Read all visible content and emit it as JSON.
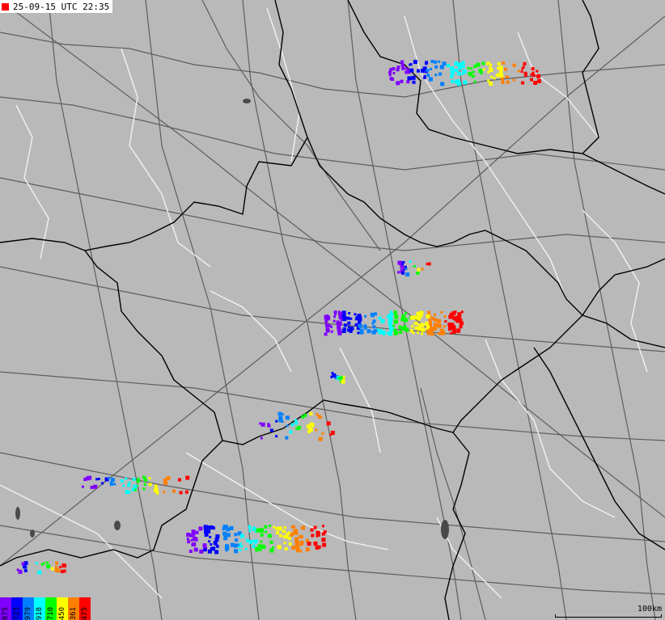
{
  "header": {
    "timestamp": "25-09-15 UTC 22:35",
    "marker_color": "#ff0000"
  },
  "legend": {
    "items": [
      {
        "label": "875",
        "color": "#8000ff"
      },
      {
        "label": "723",
        "color": "#0000ff"
      },
      {
        "label": "979",
        "color": "#0080ff"
      },
      {
        "label": "918",
        "color": "#00ffff"
      },
      {
        "label": "710",
        "color": "#00ff00"
      },
      {
        "label": "450",
        "color": "#ffff00"
      },
      {
        "label": "361",
        "color": "#ff8000"
      },
      {
        "label": "475",
        "color": "#ff0000"
      }
    ]
  },
  "scale": {
    "label": "100km"
  },
  "colors": {
    "land": "#b9b9b9",
    "borders": "#000000",
    "roads": "#5a5a5a",
    "rivers": "#ffffff"
  }
}
